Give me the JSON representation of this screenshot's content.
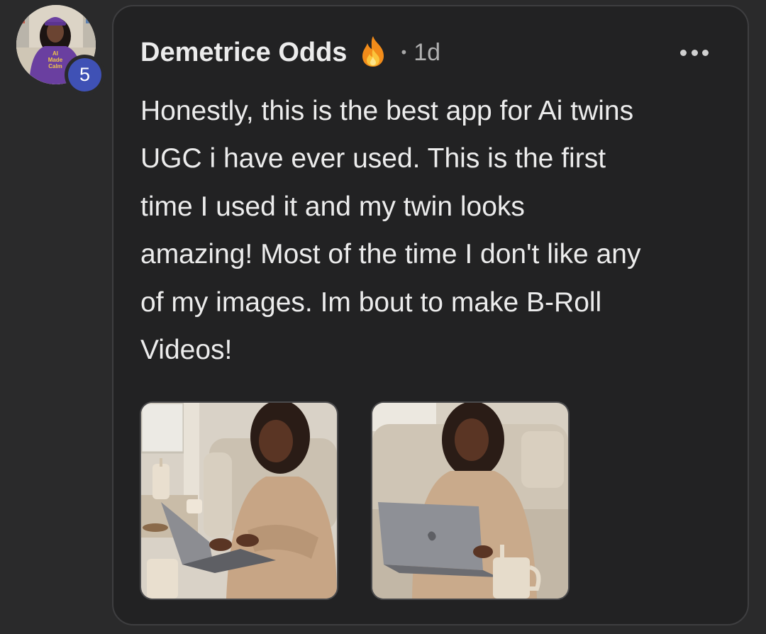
{
  "avatar": {
    "shirt_text": "AI Made Calm",
    "level_badge": "5"
  },
  "comment": {
    "author": "Demetrice Odds",
    "time_separator": "•",
    "time": "1d",
    "body": "Honestly, this is the best app for Ai twins\nUGC i have ever used. This is the first\ntime I used it and my twin looks\namazing! Most of the time I don't like any\nof my images. Im bout to make B-Roll\nVideos!"
  },
  "icons": {
    "badge": "fire-icon",
    "menu": "more-options-icon"
  },
  "colors": {
    "background": "#2a2a2b",
    "card": "#222223",
    "card_border": "#3e3e40",
    "text": "#ececec",
    "muted_text": "#b0b0b0",
    "level_badge": "#3f51b5",
    "shirt": "#6a3fa0"
  }
}
